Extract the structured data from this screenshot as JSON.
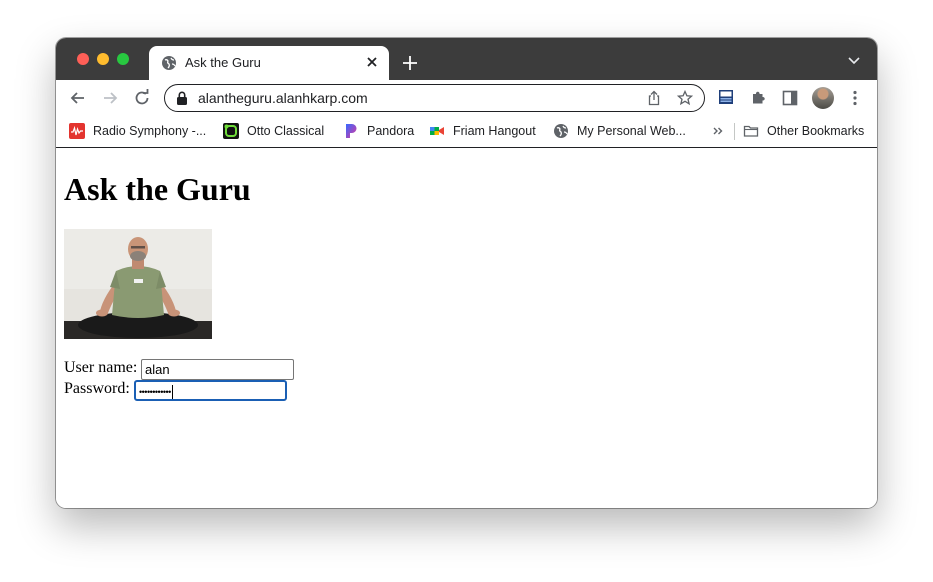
{
  "browser": {
    "tab": {
      "title": "Ask the Guru",
      "favicon": "globe-icon"
    },
    "address_bar": {
      "url": "alantheguru.alanhkarp.com"
    },
    "bookmarks": [
      {
        "label": "Radio Symphony -...",
        "icon": "radio-waveform-icon"
      },
      {
        "label": "Otto Classical",
        "icon": "otto-icon"
      },
      {
        "label": "Pandora",
        "icon": "pandora-icon"
      },
      {
        "label": "Friam Hangout",
        "icon": "meet-icon"
      },
      {
        "label": "My Personal Web...",
        "icon": "globe-icon"
      }
    ],
    "other_bookmarks": "Other Bookmarks"
  },
  "page": {
    "title": "Ask the Guru",
    "image_subject": "man in green shirt sitting cross-legged in meditation pose",
    "form": {
      "username_label": "User name:",
      "username_value": "alan",
      "password_label": "Password:",
      "password_mask": "••••••••••••"
    }
  },
  "colors": {
    "tabstrip": "#3c3c3c",
    "focus_ring": "#1a5fb4",
    "close": "#fe5f57",
    "minimize": "#ffbc2e",
    "zoom": "#28c840"
  }
}
